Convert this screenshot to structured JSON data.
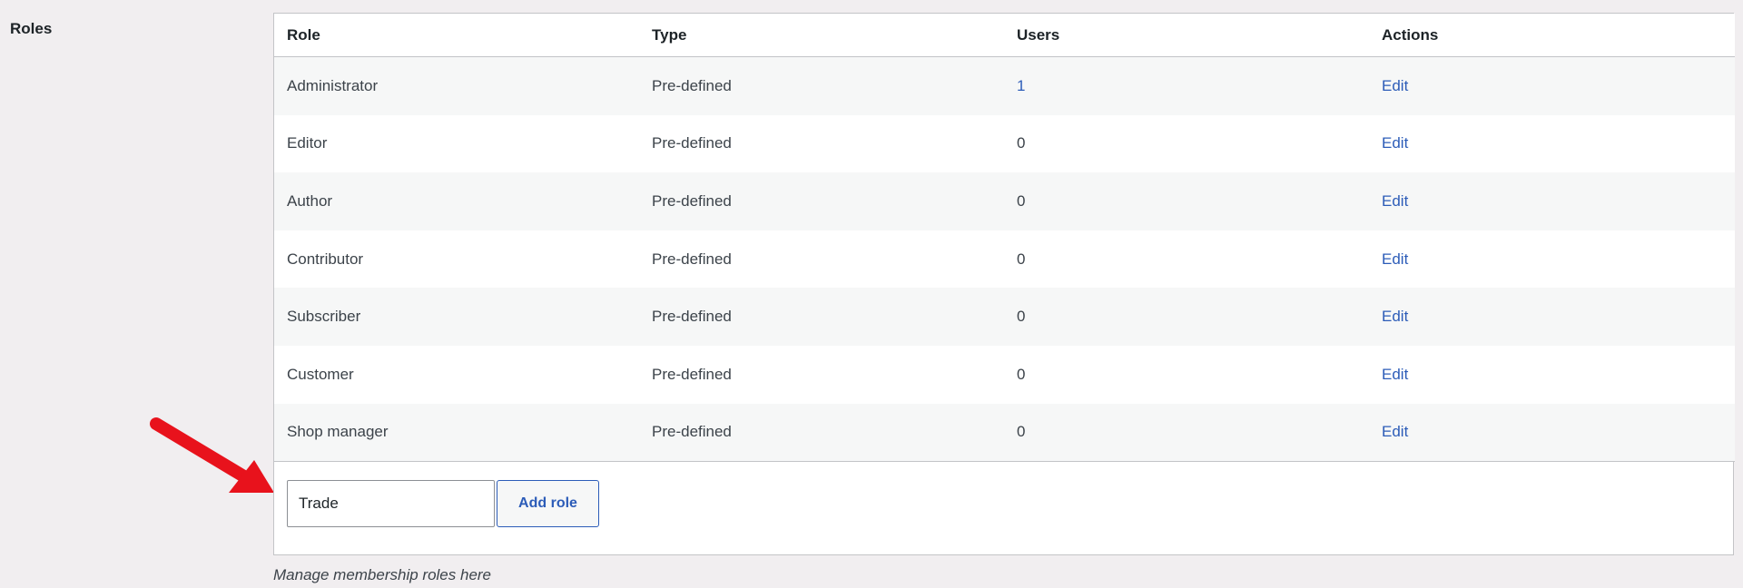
{
  "section": {
    "label": "Roles"
  },
  "table": {
    "headers": [
      "Role",
      "Type",
      "Users",
      "Actions"
    ],
    "rows": [
      {
        "role": "Administrator",
        "type": "Pre-defined",
        "users": "1",
        "action": "Edit"
      },
      {
        "role": "Editor",
        "type": "Pre-defined",
        "users": "0",
        "action": "Edit"
      },
      {
        "role": "Author",
        "type": "Pre-defined",
        "users": "0",
        "action": "Edit"
      },
      {
        "role": "Contributor",
        "type": "Pre-defined",
        "users": "0",
        "action": "Edit"
      },
      {
        "role": "Subscriber",
        "type": "Pre-defined",
        "users": "0",
        "action": "Edit"
      },
      {
        "role": "Customer",
        "type": "Pre-defined",
        "users": "0",
        "action": "Edit"
      },
      {
        "role": "Shop manager",
        "type": "Pre-defined",
        "users": "0",
        "action": "Edit"
      }
    ]
  },
  "add_role": {
    "input_value": "Trade",
    "button_label": "Add role"
  },
  "help": {
    "text": "Manage membership roles here"
  },
  "colors": {
    "link": "#2c5cb8",
    "annotation_arrow": "#e8121c"
  },
  "icons": {
    "annotation": "red-arrow-icon"
  }
}
